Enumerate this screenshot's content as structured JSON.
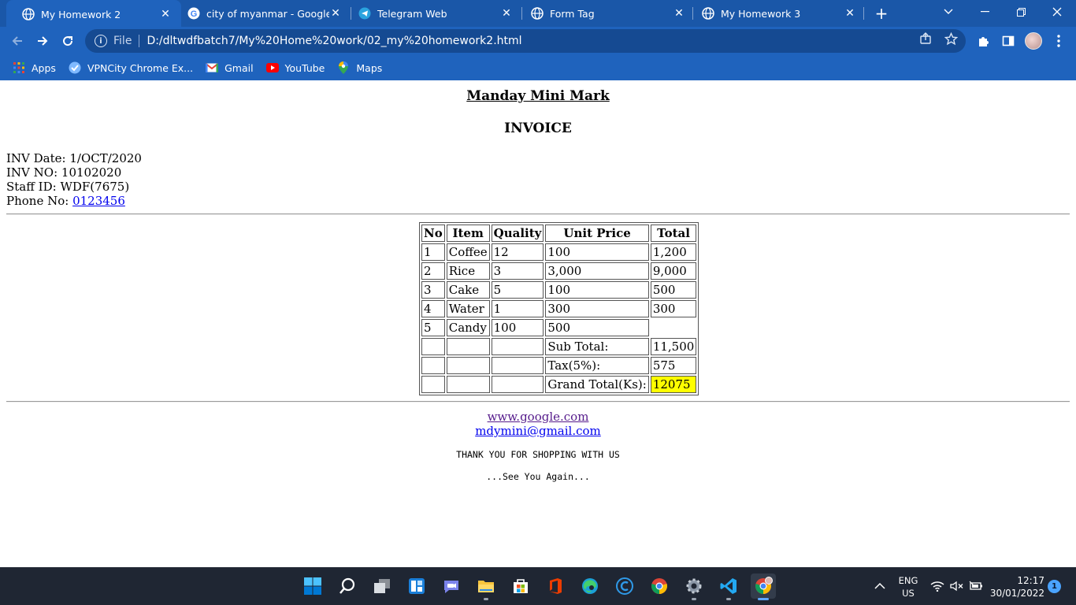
{
  "browser": {
    "tabs": [
      {
        "title": "My Homework 2",
        "active": true,
        "icon": "globe-icon"
      },
      {
        "title": "city of myanmar - Google Se",
        "active": false,
        "icon": "google-icon"
      },
      {
        "title": "Telegram Web",
        "active": false,
        "icon": "telegram-icon"
      },
      {
        "title": "Form Tag",
        "active": false,
        "icon": "globe-icon"
      },
      {
        "title": "My Homework 3",
        "active": false,
        "icon": "globe-icon"
      }
    ],
    "address": {
      "scheme": "File",
      "url": "D:/dltwdfbatch7/My%20Home%20work/02_my%20homework2.html"
    },
    "bookmarks": [
      {
        "label": "Apps",
        "icon": "apps-grid-icon"
      },
      {
        "label": "VPNCity Chrome Ex...",
        "icon": "vpncity-icon"
      },
      {
        "label": "Gmail",
        "icon": "gmail-icon"
      },
      {
        "label": "YouTube",
        "icon": "youtube-icon"
      },
      {
        "label": "Maps",
        "icon": "maps-icon"
      }
    ],
    "theme_color": "#1f63bd"
  },
  "page": {
    "shop_name": "Manday Mini Mark",
    "invoice_title": "INVOICE",
    "meta": {
      "date_label": "INV Date: ",
      "date": "1/OCT/2020",
      "number_label": "INV NO: ",
      "number": "10102020",
      "staff_label": "Staff ID: ",
      "staff": "WDF(7675)",
      "phone_label": "Phone No: ",
      "phone": "0123456"
    },
    "table": {
      "headers": [
        "No",
        "Item",
        "Quality",
        "Unit Price",
        "Total"
      ],
      "rows": [
        [
          "1",
          "Coffee",
          "12",
          "100",
          "1,200"
        ],
        [
          "2",
          "Rice",
          "3",
          "3,000",
          "9,000"
        ],
        [
          "3",
          "Cake",
          "5",
          "100",
          "500"
        ],
        [
          "4",
          "Water",
          "1",
          "300",
          "300"
        ],
        [
          "5",
          "Candy",
          "100",
          "500",
          ""
        ]
      ],
      "subtotal_label": "Sub Total:",
      "subtotal": "11,500",
      "tax_label": "Tax(5%):",
      "tax": "575",
      "grand_label": "Grand Total(Ks):",
      "grand": "12075",
      "grand_highlight": "#ffff00"
    },
    "links": {
      "website": "www.google.com",
      "email": "mdymini@gmail.com"
    },
    "thanks": "THANK YOU FOR SHOPPING WITH US",
    "see_you": "...See You Again..."
  },
  "taskbar": {
    "apps": [
      "windows-start-icon",
      "search-icon",
      "task-view-icon",
      "widgets-icon",
      "teams-chat-icon",
      "file-explorer-icon",
      "microsoft-store-icon",
      "office-icon",
      "edge-icon",
      "ccleaner-icon",
      "chrome-icon",
      "settings-icon",
      "vscode-icon",
      "chrome-profile-icon"
    ],
    "lang_line1": "ENG",
    "lang_line2": "US",
    "time": "12:17",
    "date": "30/01/2022",
    "notifications": "1"
  }
}
